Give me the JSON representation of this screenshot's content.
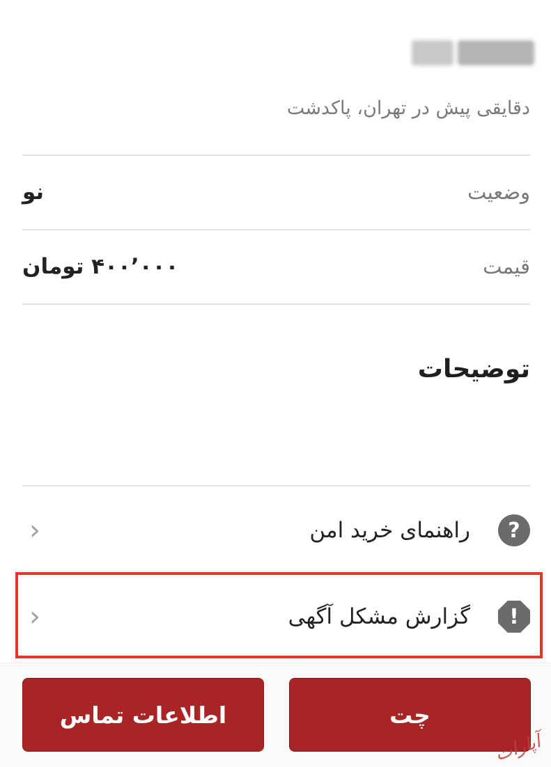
{
  "listing": {
    "subtitle": "دقایقی پیش در تهران، پاکدشت"
  },
  "details": [
    {
      "label": "وضعیت",
      "value": "نو"
    },
    {
      "label": "قیمت",
      "value": "۴۰۰٬۰۰۰ تومان"
    }
  ],
  "description": {
    "title": "توضیحات"
  },
  "links": {
    "safe_buy": {
      "label": "راهنمای خرید امن",
      "icon": "question-icon",
      "icon_glyph": "?",
      "chevron": "‹"
    },
    "report": {
      "label": "گزارش مشکل آگهی",
      "icon": "alert-icon",
      "icon_glyph": "!",
      "chevron": "‹"
    }
  },
  "actions": {
    "contact_label": "اطلاعات تماس",
    "chat_label": "چت"
  },
  "watermark": {
    "text": "آپارات"
  },
  "colors": {
    "primary": "#a92424",
    "highlight": "#e0372b"
  }
}
